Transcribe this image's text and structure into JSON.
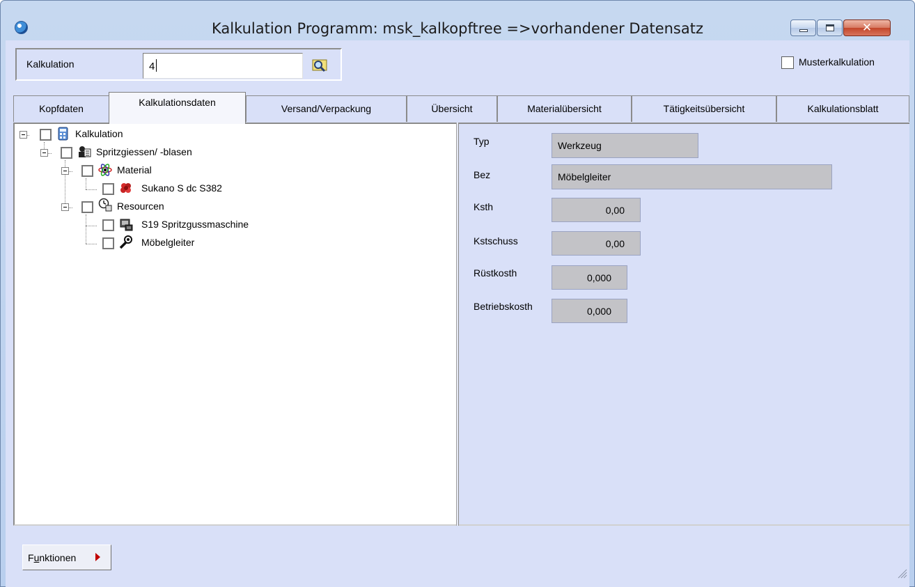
{
  "window": {
    "title": "Kalkulation Programm: msk_kalkopftree =>vorhandener Datensatz",
    "close_glyph": "✕"
  },
  "header": {
    "kalkulation_label": "Kalkulation",
    "kalkulation_value": "4",
    "search_icon": "binoculars-search-icon",
    "muster_label": "Musterkalkulation",
    "muster_checked": false
  },
  "tabs": [
    {
      "label": "Kopfdaten",
      "active": false
    },
    {
      "label": "Kalkulationsdaten",
      "active": true
    },
    {
      "label": "Versand/Verpackung",
      "active": false
    },
    {
      "label": "Übersicht",
      "active": false
    },
    {
      "label": "Materialübersicht",
      "active": false
    },
    {
      "label": "Tätigkeitsübersicht",
      "active": false
    },
    {
      "label": "Kalkulationsblatt",
      "active": false
    }
  ],
  "tree": [
    {
      "label": "Kalkulation",
      "icon": "calculation-document-icon",
      "expanded": true,
      "level": 0
    },
    {
      "label": "Spritzgiessen/ -blasen",
      "icon": "process-icon",
      "expanded": true,
      "level": 1
    },
    {
      "label": "Material",
      "icon": "material-icon",
      "expanded": true,
      "level": 2
    },
    {
      "label": "Sukano S dc S382",
      "icon": "granulate-icon",
      "level": 3
    },
    {
      "label": "Resourcen",
      "icon": "resources-clock-icon",
      "expanded": true,
      "level": 2
    },
    {
      "label": "S19 Spritzgussmaschine",
      "icon": "machine-icon",
      "level": 3
    },
    {
      "label": "Möbelgleiter",
      "icon": "tool-wrench-icon",
      "level": 3
    }
  ],
  "details": {
    "typ_label": "Typ",
    "typ_value": "Werkzeug",
    "bez_label": "Bez",
    "bez_value": "Möbelgleiter",
    "ksth_label": "Ksth",
    "ksth_value": "0,00",
    "kstschuss_label": "Kstschuss",
    "kstschuss_value": "0,00",
    "ruestkosth_label": "Rüstkosth",
    "ruestkosth_value": "0,000",
    "betriebskosth_label": "Betriebskosth",
    "betriebskosth_value": "0,000"
  },
  "footer": {
    "funktionen_prefix": "F",
    "funktionen_underlined": "u",
    "funktionen_rest": "nktionen"
  }
}
